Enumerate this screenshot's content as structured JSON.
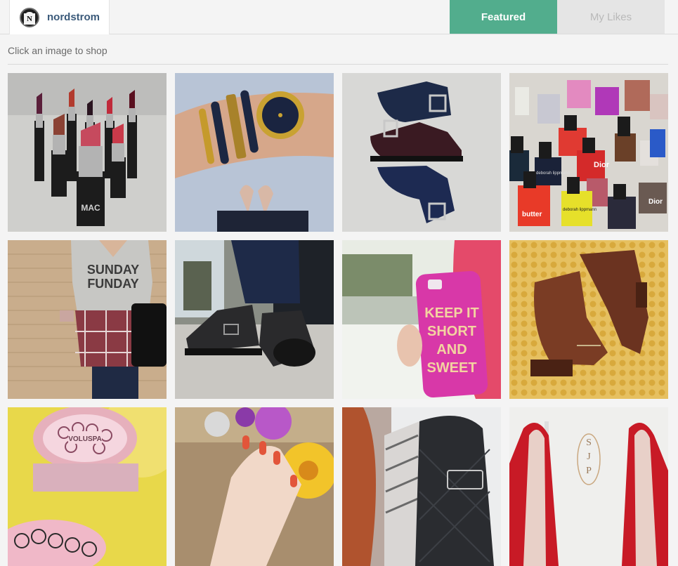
{
  "brand": {
    "name": "nordstrom",
    "logo_letter": "N"
  },
  "tabs": {
    "featured": "Featured",
    "likes": "My Likes"
  },
  "subtitle": "Click an image to shop",
  "colors": {
    "accent": "#52ad8d",
    "brand_text": "#3b5a7a"
  },
  "tiles": [
    {
      "subject": "lipsticks",
      "brand_mark": "MAC"
    },
    {
      "subject": "wrist-watch-bracelets"
    },
    {
      "subject": "navy-buckle-boots"
    },
    {
      "subject": "nail-polish",
      "labels": [
        "Dior",
        "butter",
        "deborah lippmann",
        "deborah lippmann",
        "Dior"
      ]
    },
    {
      "subject": "sunday-funday-tee",
      "shirt_text": [
        "SUNDAY",
        "FUNDAY"
      ]
    },
    {
      "subject": "black-buckle-boots"
    },
    {
      "subject": "phone-case",
      "case_text": [
        "KEEP IT",
        "SHORT",
        "AND",
        "SWEET"
      ]
    },
    {
      "subject": "brown-ankle-boots"
    },
    {
      "subject": "voluspa-candles",
      "label": "VOLUSPA"
    },
    {
      "subject": "manicure-flowers"
    },
    {
      "subject": "quilted-backpack"
    },
    {
      "subject": "red-heels",
      "monogram": [
        "S",
        "J",
        "P"
      ]
    }
  ]
}
